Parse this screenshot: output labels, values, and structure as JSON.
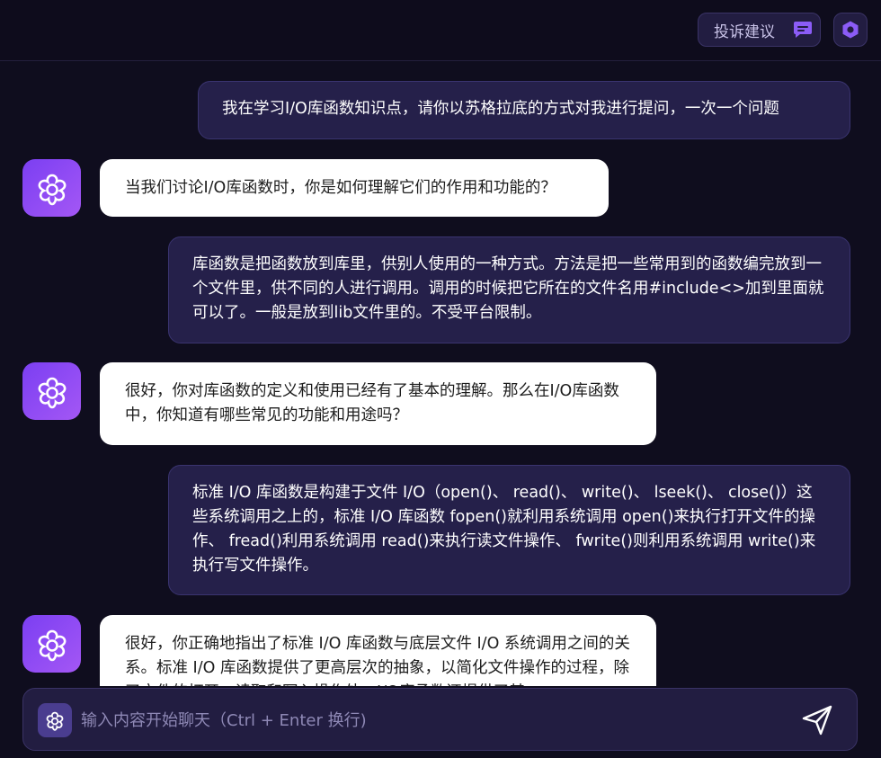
{
  "header": {
    "feedback_label": "投诉建议",
    "feedback_icon": "chat-bubble-icon",
    "settings_icon": "hexagon-settings-icon"
  },
  "colors": {
    "background": "#0f0d1e",
    "user_bubble": "#25204a",
    "bot_bubble": "#ffffff",
    "accent": "#8b5cf6"
  },
  "messages": [
    {
      "role": "user",
      "text": "我在学习I/O库函数知识点，请你以苏格拉底的方式对我进行提问，一次一个问题"
    },
    {
      "role": "assistant",
      "text": "当我们讨论I/O库函数时，你是如何理解它们的作用和功能的？"
    },
    {
      "role": "user",
      "text": "库函数是把函数放到库里，供别人使用的一种方式。方法是把一些常用到的函数编完放到一个文件里，供不同的人进行调用。调用的时候把它所在的文件名用#include<>加到里面就可以了。一般是放到lib文件里的。不受平台限制。"
    },
    {
      "role": "assistant",
      "text": "很好，你对库函数的定义和使用已经有了基本的理解。那么在I/O库函数中，你知道有哪些常见的功能和用途吗？"
    },
    {
      "role": "user",
      "text": "标准 I/O 库函数是构建于文件 I/O（open()、 read()、 write()、 lseek()、 close()）这些系统调用之上的，标准 I/O 库函数 fopen()就利用系统调用 open()来执行打开文件的操作、 fread()利用系统调用 read()来执行读文件操作、 fwrite()则利用系统调用 write()来执行写文件操作。"
    },
    {
      "role": "assistant",
      "text": "很好，你正确地指出了标准 I/O 库函数与底层文件 I/O 系统调用之间的关系。标准 I/O 库函数提供了更高层次的抽象，以简化文件操作的过程，除了文件的打开、读取和写入操作外，I/O库函数还提供了其"
    }
  ],
  "input": {
    "placeholder": "输入内容开始聊天（Ctrl + Enter 换行)",
    "value": "",
    "send_icon": "send-icon",
    "logo_icon": "flower-logo-icon"
  },
  "avatar_icon": "flower-logo-icon"
}
